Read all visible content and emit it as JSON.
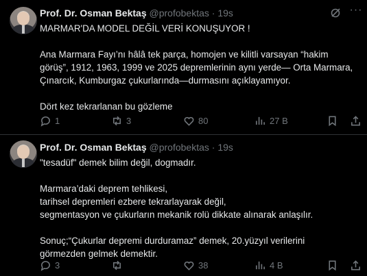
{
  "posts": [
    {
      "author": "Prof. Dr. Osman Bektaş",
      "handle": "@profobektas",
      "separator": "·",
      "time": "19s",
      "lines": [
        "MARMAR'DA MODEL DEĞİL VERİ KONUŞUYOR !",
        "",
        "Ana Marmara Fayı’nı hâlâ tek parça, homojen ve kilitli varsayan “hakim",
        "görüş”, 1912, 1963, 1999 ve 2025 depremlerinin aynı yerde— Orta Marmara,",
        "Çınarcık, Kumburgaz çukurlarında—durmasını açıklayamıyor.",
        "",
        "Dört kez tekrarlanan bu gözleme"
      ],
      "stats": {
        "replies": "1",
        "reposts": "3",
        "likes": "80",
        "views": "27 B"
      }
    },
    {
      "author": "Prof. Dr. Osman Bektaş",
      "handle": "@profobektas",
      "separator": "·",
      "time": "19s",
      "lines": [
        "\"tesadüf\" demek bilim değil, dogmadır.",
        "",
        "Marmara’daki deprem tehlikesi,",
        "tarihsel depremleri ezbere tekrarlayarak değil,",
        "segmentasyon ve çukurların mekanik rolü dikkate alınarak anlaşılır.",
        "",
        "Sonuç;“Çukurlar depremi durduramaz” demek, 20.yüzyıl verilerini",
        "görmezden gelmek demektir."
      ],
      "stats": {
        "replies": "3",
        "reposts": "",
        "likes": "38",
        "views": "4 B"
      }
    }
  ],
  "icons": [
    "grok-icon",
    "more-icon",
    "reply-icon",
    "repost-icon",
    "like-icon",
    "views-icon",
    "bookmark-icon",
    "share-icon"
  ],
  "colors": {
    "background": "#000000",
    "text": "#e7e9ea",
    "muted": "#71767b",
    "divider": "#2f3336"
  }
}
